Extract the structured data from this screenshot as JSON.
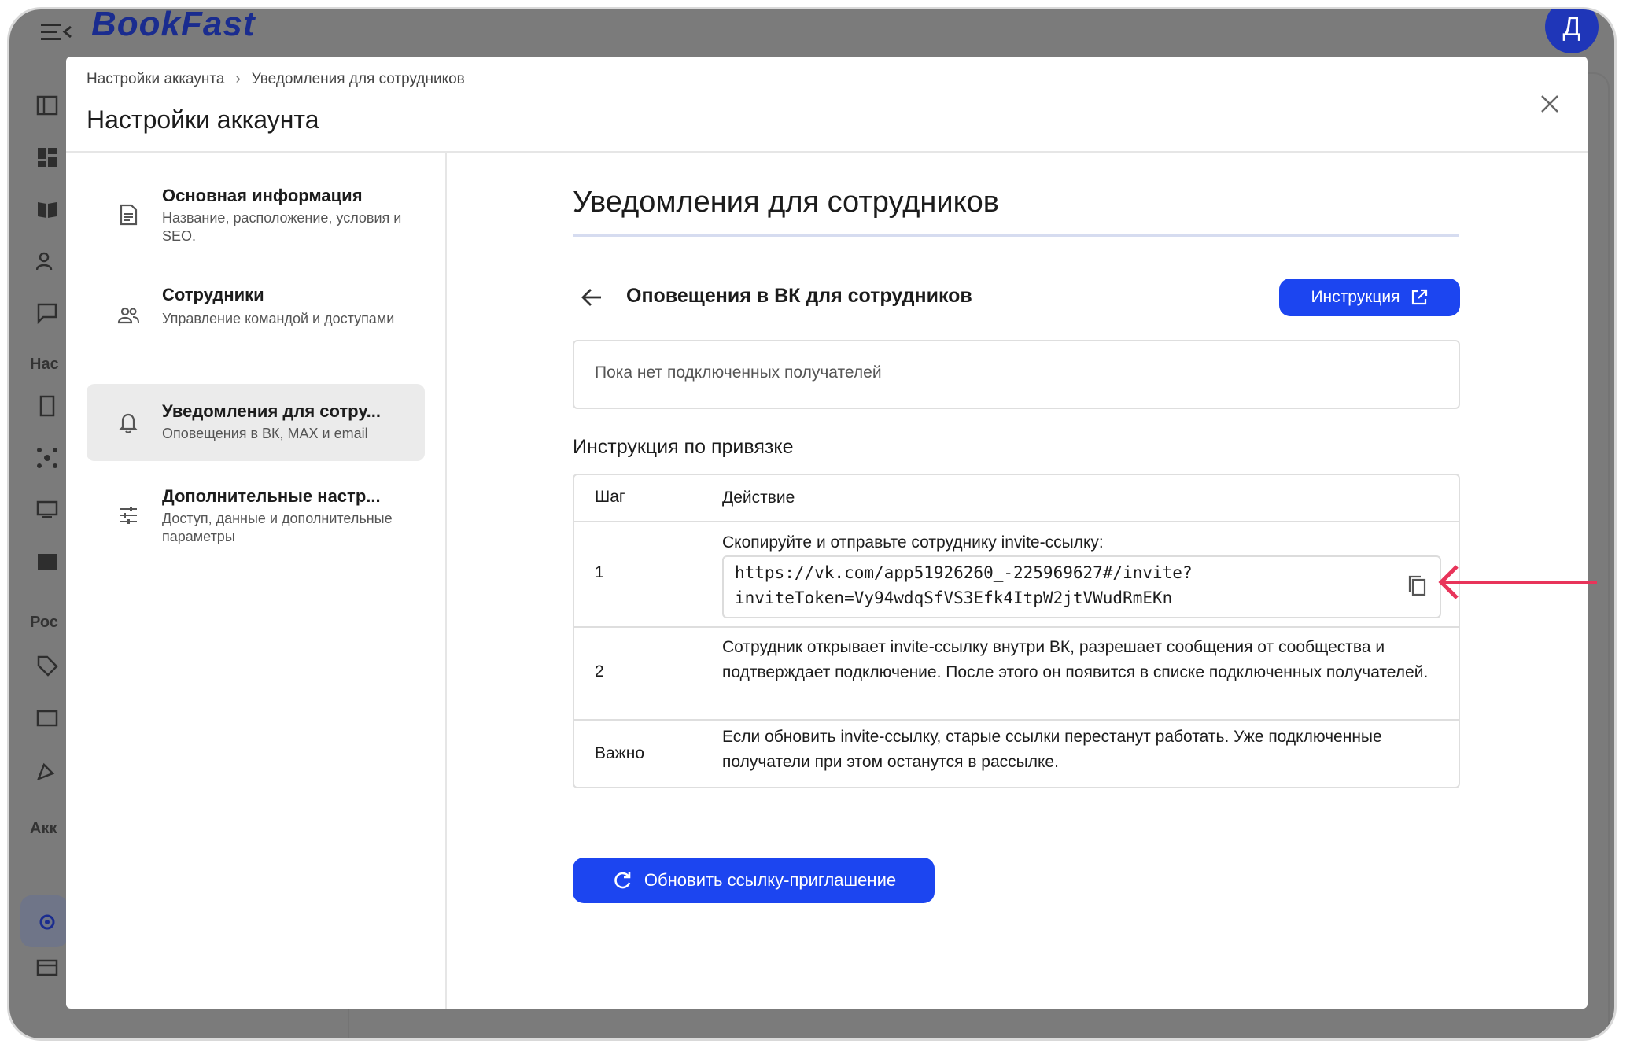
{
  "app": {
    "logo": "BookFast",
    "avatar_letter": "Д",
    "sidebar_sections": [
      "Нас",
      "Рос",
      "Акк"
    ]
  },
  "modal": {
    "breadcrumb": [
      "Настройки аккаунта",
      "Уведомления для сотрудников"
    ],
    "breadcrumb_sep": "›",
    "title": "Настройки аккаунта"
  },
  "nav": {
    "items": [
      {
        "title": "Основная информация",
        "subtitle": "Название, расположение, условия и SEO.",
        "icon": "document-icon",
        "active": false
      },
      {
        "title": "Сотрудники",
        "subtitle": "Управление командой и доступами",
        "icon": "people-icon",
        "active": false
      },
      {
        "title": "Уведомления для сотру...",
        "subtitle": "Оповещения в ВК, MAX и email",
        "icon": "bell-icon",
        "active": true
      },
      {
        "title": "Дополнительные настр...",
        "subtitle": "Доступ, данные и дополнительные параметры",
        "icon": "sliders-icon",
        "active": false
      }
    ]
  },
  "content": {
    "section_title": "Уведомления для сотрудников",
    "subsection_title": "Оповещения в ВК для сотрудников",
    "instruction_button": "Инструкция",
    "empty_text": "Пока нет подключенных получателей",
    "binding_heading": "Инструкция по привязке",
    "table": {
      "headers": [
        "Шаг",
        "Действие"
      ],
      "rows": [
        {
          "step": "1",
          "action": "Скопируйте и отправьте сотруднику invite-ссылку:",
          "link": "https://vk.com/app51926260_-225969627#/invite?\ninviteToken=Vy94wdqSfVS3Efk4ItpW2jtVWudRmEKn"
        },
        {
          "step": "2",
          "action": "Сотрудник открывает invite-ссылку внутри ВК, разрешает сообщения от сообщества и подтверждает подключение. После этого он появится в списке подключенных получателей."
        },
        {
          "step": "Важно",
          "action": "Если обновить invite-ссылку, старые ссылки перестанут работать. Уже подключенные получатели при этом останутся в рассылке."
        }
      ]
    },
    "refresh_button": "Обновить ссылку-приглашение"
  },
  "colors": {
    "accent": "#1c45f0",
    "annotation_arrow": "#e8345a",
    "overlay": "#7b7b7b"
  }
}
